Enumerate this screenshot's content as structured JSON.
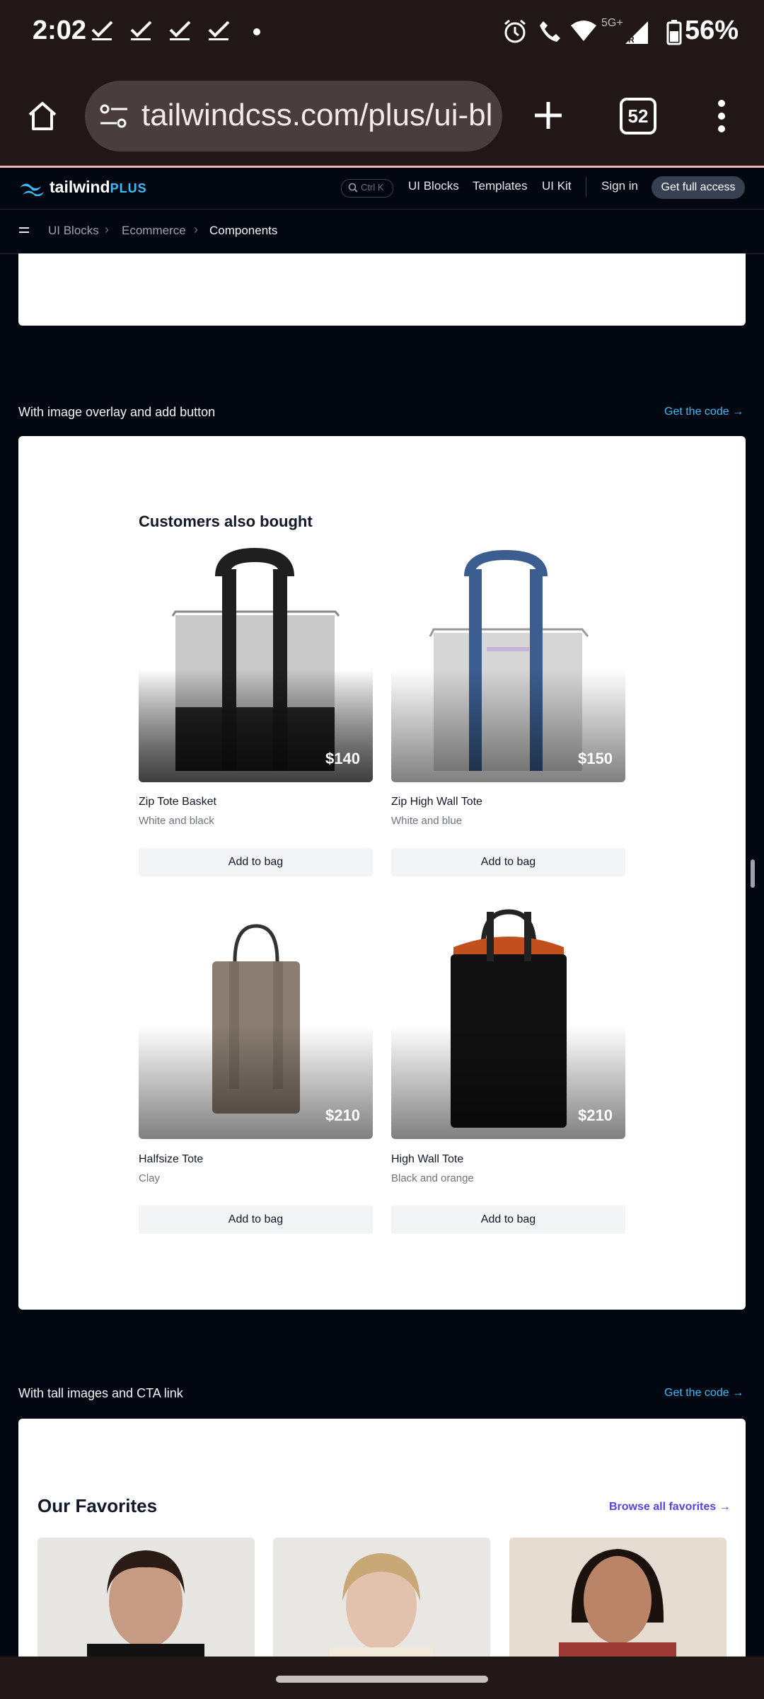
{
  "status_bar": {
    "time": "2:02",
    "network": "5G+",
    "battery": "56%"
  },
  "browser": {
    "url": "tailwindcss.com/plus/ui-blocks/ecommerce/components",
    "tab_count": "52"
  },
  "site_header": {
    "logo_main": "tailwind",
    "logo_plus": "PLUS",
    "search_hint": "Ctrl K",
    "nav": [
      "UI Blocks",
      "Templates",
      "UI Kit"
    ],
    "sign_in": "Sign in",
    "cta": "Get full access"
  },
  "breadcrumb": {
    "items": [
      "UI Blocks",
      "Ecommerce",
      "Components"
    ]
  },
  "section1": {
    "title": "With image overlay and add button",
    "get_code": "Get the code →"
  },
  "customers_also_bought": {
    "heading": "Customers also bought",
    "products": [
      {
        "name": "Zip Tote Basket",
        "color": "White and black",
        "price": "$140",
        "button": "Add to bag"
      },
      {
        "name": "Zip High Wall Tote",
        "color": "White and blue",
        "price": "$150",
        "button": "Add to bag"
      },
      {
        "name": "Halfsize Tote",
        "color": "Clay",
        "price": "$210",
        "button": "Add to bag"
      },
      {
        "name": "High Wall Tote",
        "color": "Black and orange",
        "price": "$210",
        "button": "Add to bag"
      }
    ]
  },
  "section2": {
    "title": "With tall images and CTA link",
    "get_code": "Get the code →"
  },
  "favorites": {
    "heading": "Our Favorites",
    "browse_link": "Browse all favorites →"
  }
}
